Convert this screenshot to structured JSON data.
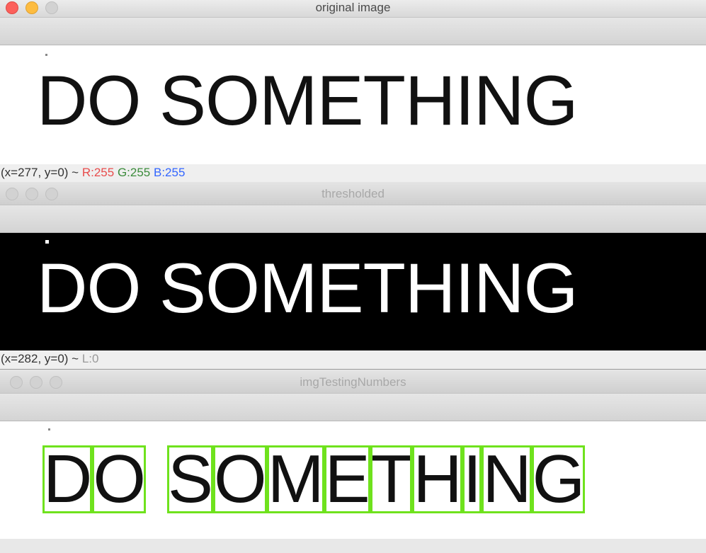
{
  "windows": [
    {
      "title": "original image",
      "image_text": "DO SOMETHING",
      "status": {
        "coords": "(x=277, y=0) ~",
        "r": "R:255",
        "g": "G:255",
        "b": "B:255"
      }
    },
    {
      "title": "thresholded",
      "image_text": "DO SOMETHING",
      "status": {
        "coords": "(x=282, y=0) ~",
        "l": "L:0"
      }
    },
    {
      "title": "imgTestingNumbers",
      "image_text": "DO SOMETHING"
    }
  ],
  "colors": {
    "close": "#fc605b",
    "minimize": "#fdbc40",
    "box": "#6fe21d",
    "r": "#e84c4c",
    "g": "#3c8c3c",
    "b": "#3366ff"
  }
}
